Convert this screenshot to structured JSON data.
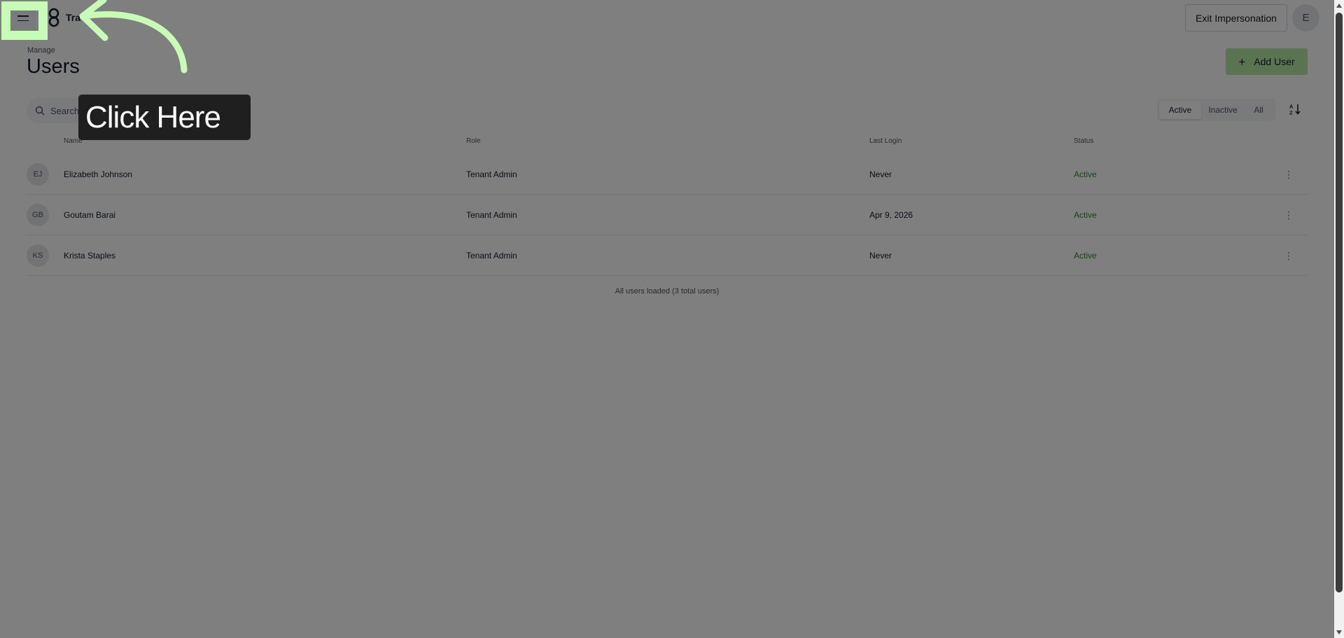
{
  "header": {
    "brand": "Tra",
    "exit_button": "Exit Impersonation",
    "avatar_initial": "E"
  },
  "page": {
    "overline": "Manage",
    "title": "Users",
    "add_button": "Add User",
    "search_placeholder": "Search"
  },
  "filters": {
    "options": [
      "Active",
      "Inactive",
      "All"
    ],
    "selected": "Active"
  },
  "table": {
    "columns": [
      "Name",
      "Role",
      "Last Login",
      "Status"
    ],
    "rows": [
      {
        "initials": "EJ",
        "name": "Elizabeth Johnson",
        "role": "Tenant Admin",
        "last_login": "Never",
        "status": "Active"
      },
      {
        "initials": "GB",
        "name": "Goutam Barai",
        "role": "Tenant Admin",
        "last_login": "Apr 9, 2026",
        "status": "Active"
      },
      {
        "initials": "KS",
        "name": "Krista Staples",
        "role": "Tenant Admin",
        "last_login": "Never",
        "status": "Active"
      }
    ],
    "footer": "All users loaded (3 total users)"
  },
  "tutorial": {
    "tooltip": "Click Here"
  },
  "colors": {
    "accent": "#b4e8a5",
    "status_active": "#2e8a27",
    "highlight": "#c8fbb8"
  }
}
